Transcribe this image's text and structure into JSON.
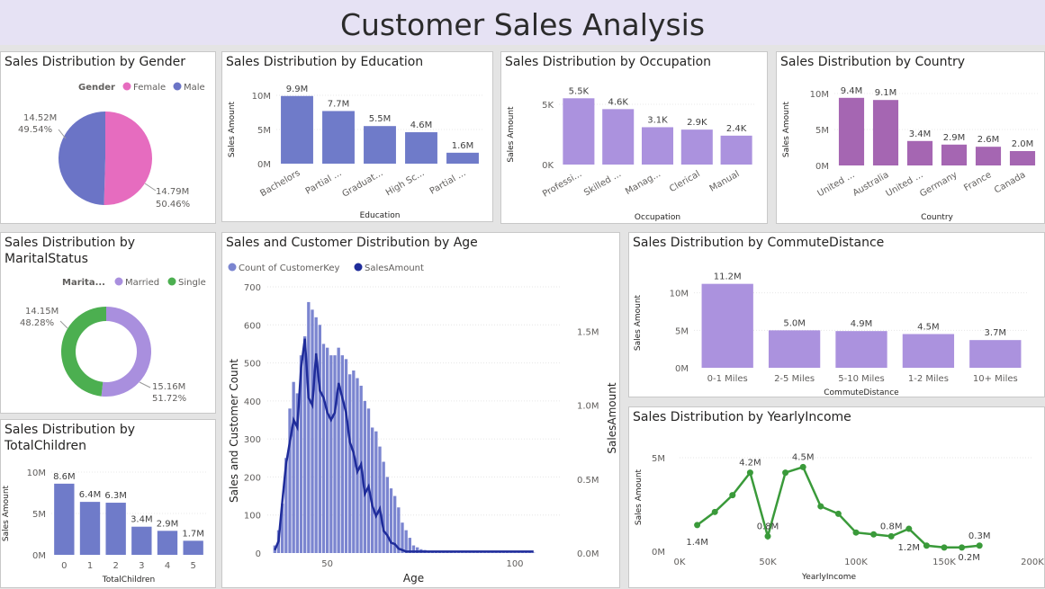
{
  "header": {
    "title": "Customer Sales Analysis"
  },
  "colors": {
    "female": "#e66cbf",
    "male": "#6b74c6",
    "married": "#a98fde",
    "single": "#4caf50",
    "blue_bar": "#6f7bc9",
    "purple_bar": "#ab92de",
    "magenta_bar": "#a566b2",
    "line_green": "#3a9a3a",
    "age_bar": "#7b85d0",
    "age_line": "#1f2c9a"
  },
  "gender": {
    "title": "Sales Distribution by Gender",
    "legend_title": "Gender",
    "legend": [
      "Female",
      "Male"
    ],
    "chart_data": {
      "type": "pie",
      "labels": [
        "Female",
        "Male"
      ],
      "values": [
        14.79,
        14.52
      ],
      "percents": [
        "50.46%",
        "49.54%"
      ],
      "value_labels": [
        "14.79M",
        "14.52M"
      ]
    }
  },
  "education": {
    "title": "Sales Distribution by Education",
    "chart_data": {
      "type": "bar",
      "categories": [
        "Bachelors",
        "Partial ...",
        "Graduat...",
        "High Sc...",
        "Partial ..."
      ],
      "values": [
        9.9,
        7.7,
        5.5,
        4.6,
        1.6
      ],
      "data_labels": [
        "9.9M",
        "7.7M",
        "5.5M",
        "4.6M",
        "1.6M"
      ],
      "xlabel": "Education",
      "ylabel": "Sales Amount",
      "yticks": [
        "0M",
        "5M",
        "10M"
      ],
      "ylim": [
        0,
        10
      ]
    }
  },
  "occupation": {
    "title": "Sales Distribution by Occupation",
    "chart_data": {
      "type": "bar",
      "categories": [
        "Professi...",
        "Skilled ...",
        "Manag...",
        "Clerical",
        "Manual"
      ],
      "values": [
        5.5,
        4.6,
        3.1,
        2.9,
        2.4
      ],
      "data_labels": [
        "5.5K",
        "4.6K",
        "3.1K",
        "2.9K",
        "2.4K"
      ],
      "xlabel": "Occupation",
      "ylabel": "Sales Amount",
      "yticks": [
        "0K",
        "5K"
      ],
      "ylim": [
        0,
        5
      ]
    }
  },
  "country": {
    "title": "Sales Distribution by Country",
    "chart_data": {
      "type": "bar",
      "categories": [
        "United ...",
        "Australia",
        "United ...",
        "Germany",
        "France",
        "Canada"
      ],
      "values": [
        9.4,
        9.1,
        3.4,
        2.9,
        2.6,
        2.0
      ],
      "data_labels": [
        "9.4M",
        "9.1M",
        "3.4M",
        "2.9M",
        "2.6M",
        "2.0M"
      ],
      "xlabel": "Country",
      "ylabel": "Sales Amount",
      "yticks": [
        "0M",
        "5M",
        "10M"
      ],
      "ylim": [
        0,
        10
      ]
    }
  },
  "marital": {
    "title": "Sales Distribution by MaritalStatus",
    "legend_title": "Marita...",
    "legend": [
      "Married",
      "Single"
    ],
    "chart_data": {
      "type": "pie",
      "labels": [
        "Married",
        "Single"
      ],
      "values": [
        15.16,
        14.15
      ],
      "percents": [
        "51.72%",
        "48.28%"
      ],
      "value_labels": [
        "15.16M",
        "14.15M"
      ]
    }
  },
  "children": {
    "title": "Sales Distribution by TotalChildren",
    "chart_data": {
      "type": "bar",
      "categories": [
        "0",
        "1",
        "2",
        "3",
        "4",
        "5"
      ],
      "values": [
        8.6,
        6.4,
        6.3,
        3.4,
        2.9,
        1.7
      ],
      "data_labels": [
        "8.6M",
        "6.4M",
        "6.3M",
        "3.4M",
        "2.9M",
        "1.7M"
      ],
      "xlabel": "TotalChildren",
      "ylabel": "Sales Amount",
      "yticks": [
        "0M",
        "5M",
        "10M"
      ],
      "ylim": [
        0,
        10
      ]
    }
  },
  "age": {
    "title": "Sales and Customer Distribution by Age",
    "legend": [
      "Count of CustomerKey",
      "SalesAmount"
    ],
    "chart_data": {
      "type": "bar",
      "xlabel": "Age",
      "ylabel": "Sales and Customer Count",
      "y2label": "SalesAmount",
      "xticks": [
        "50",
        "100"
      ],
      "yticks": [
        "0",
        "100",
        "200",
        "300",
        "400",
        "500",
        "600",
        "700"
      ],
      "y2ticks": [
        "0.0M",
        "0.5M",
        "1.0M",
        "1.5M"
      ],
      "xlim": [
        34,
        112
      ],
      "ylim": [
        0,
        700
      ],
      "y2lim": [
        0,
        1.8
      ],
      "x": [
        36,
        37,
        38,
        39,
        40,
        41,
        42,
        43,
        44,
        45,
        46,
        47,
        48,
        49,
        50,
        51,
        52,
        53,
        54,
        55,
        56,
        57,
        58,
        59,
        60,
        61,
        62,
        63,
        64,
        65,
        66,
        67,
        68,
        69,
        70,
        71,
        72,
        73,
        74,
        75,
        76,
        77,
        78,
        79,
        80,
        81,
        82,
        83,
        84,
        85,
        86,
        87,
        88,
        89,
        90,
        91,
        92,
        93,
        94,
        95,
        96,
        97,
        98,
        99,
        100,
        101,
        102,
        103,
        104,
        105
      ],
      "series": [
        {
          "name": "Count of CustomerKey",
          "values": [
            20,
            60,
            130,
            250,
            380,
            450,
            420,
            520,
            570,
            660,
            640,
            620,
            600,
            550,
            540,
            520,
            520,
            540,
            520,
            510,
            470,
            480,
            460,
            440,
            400,
            380,
            330,
            320,
            280,
            240,
            200,
            170,
            150,
            120,
            80,
            60,
            40,
            20,
            15,
            10,
            8,
            5,
            5,
            3,
            3,
            2,
            2,
            2,
            1,
            1,
            1,
            1,
            1,
            1,
            1,
            1,
            1,
            1,
            1,
            1,
            1,
            1,
            1,
            1,
            1,
            1,
            1,
            1,
            1,
            1
          ]
        },
        {
          "name": "SalesAmount",
          "values": [
            0.02,
            0.08,
            0.35,
            0.6,
            0.75,
            0.9,
            0.85,
            1.25,
            1.45,
            1.05,
            1.0,
            1.35,
            1.1,
            1.05,
            0.95,
            0.9,
            0.95,
            1.15,
            1.05,
            0.95,
            0.75,
            0.68,
            0.55,
            0.6,
            0.4,
            0.45,
            0.32,
            0.25,
            0.3,
            0.15,
            0.12,
            0.07,
            0.06,
            0.03,
            0.02,
            0.01,
            0.01,
            0.01,
            0.01,
            0.01,
            0.01,
            0.01,
            0.01,
            0.01,
            0.01,
            0.01,
            0.01,
            0.01,
            0.01,
            0.01,
            0.01,
            0.01,
            0.01,
            0.01,
            0.01,
            0.01,
            0.01,
            0.01,
            0.01,
            0.01,
            0.01,
            0.01,
            0.01,
            0.01,
            0.01,
            0.01,
            0.01,
            0.01,
            0.01,
            0.01
          ]
        }
      ]
    }
  },
  "commute": {
    "title": "Sales Distribution by CommuteDistance",
    "chart_data": {
      "type": "bar",
      "categories": [
        "0-1 Miles",
        "2-5 Miles",
        "5-10 Miles",
        "1-2 Miles",
        "10+ Miles"
      ],
      "values": [
        11.2,
        5.0,
        4.9,
        4.5,
        3.7
      ],
      "data_labels": [
        "11.2M",
        "5.0M",
        "4.9M",
        "4.5M",
        "3.7M"
      ],
      "xlabel": "CommuteDistance",
      "ylabel": "Sales Amount",
      "yticks": [
        "0M",
        "5M",
        "10M"
      ],
      "ylim": [
        0,
        12
      ]
    }
  },
  "income": {
    "title": "Sales Distribution by YearlyIncome",
    "chart_data": {
      "type": "line",
      "x": [
        10,
        20,
        30,
        40,
        50,
        60,
        70,
        80,
        90,
        100,
        110,
        120,
        130,
        140,
        150,
        160,
        170
      ],
      "values": [
        1.4,
        2.1,
        3.0,
        4.2,
        0.8,
        4.2,
        4.5,
        2.4,
        2.0,
        1.0,
        0.9,
        0.8,
        1.2,
        0.3,
        0.2,
        0.2,
        0.3
      ],
      "point_labels": [
        {
          "i": 0,
          "text": "1.4M"
        },
        {
          "i": 3,
          "text": "4.2M"
        },
        {
          "i": 4,
          "text": "0.8M"
        },
        {
          "i": 6,
          "text": "4.5M"
        },
        {
          "i": 11,
          "text": "0.8M"
        },
        {
          "i": 12,
          "text": "1.2M"
        },
        {
          "i": 16,
          "text": "0.3M"
        },
        {
          "i": 15,
          "text": "0.2M"
        }
      ],
      "xlabel": "YearlyIncome",
      "ylabel": "Sales Amount",
      "xticks": [
        "0K",
        "50K",
        "100K",
        "150K",
        "200K"
      ],
      "yticks": [
        "0M",
        "5M"
      ],
      "xlim": [
        0,
        200
      ],
      "ylim": [
        0,
        5
      ]
    }
  }
}
